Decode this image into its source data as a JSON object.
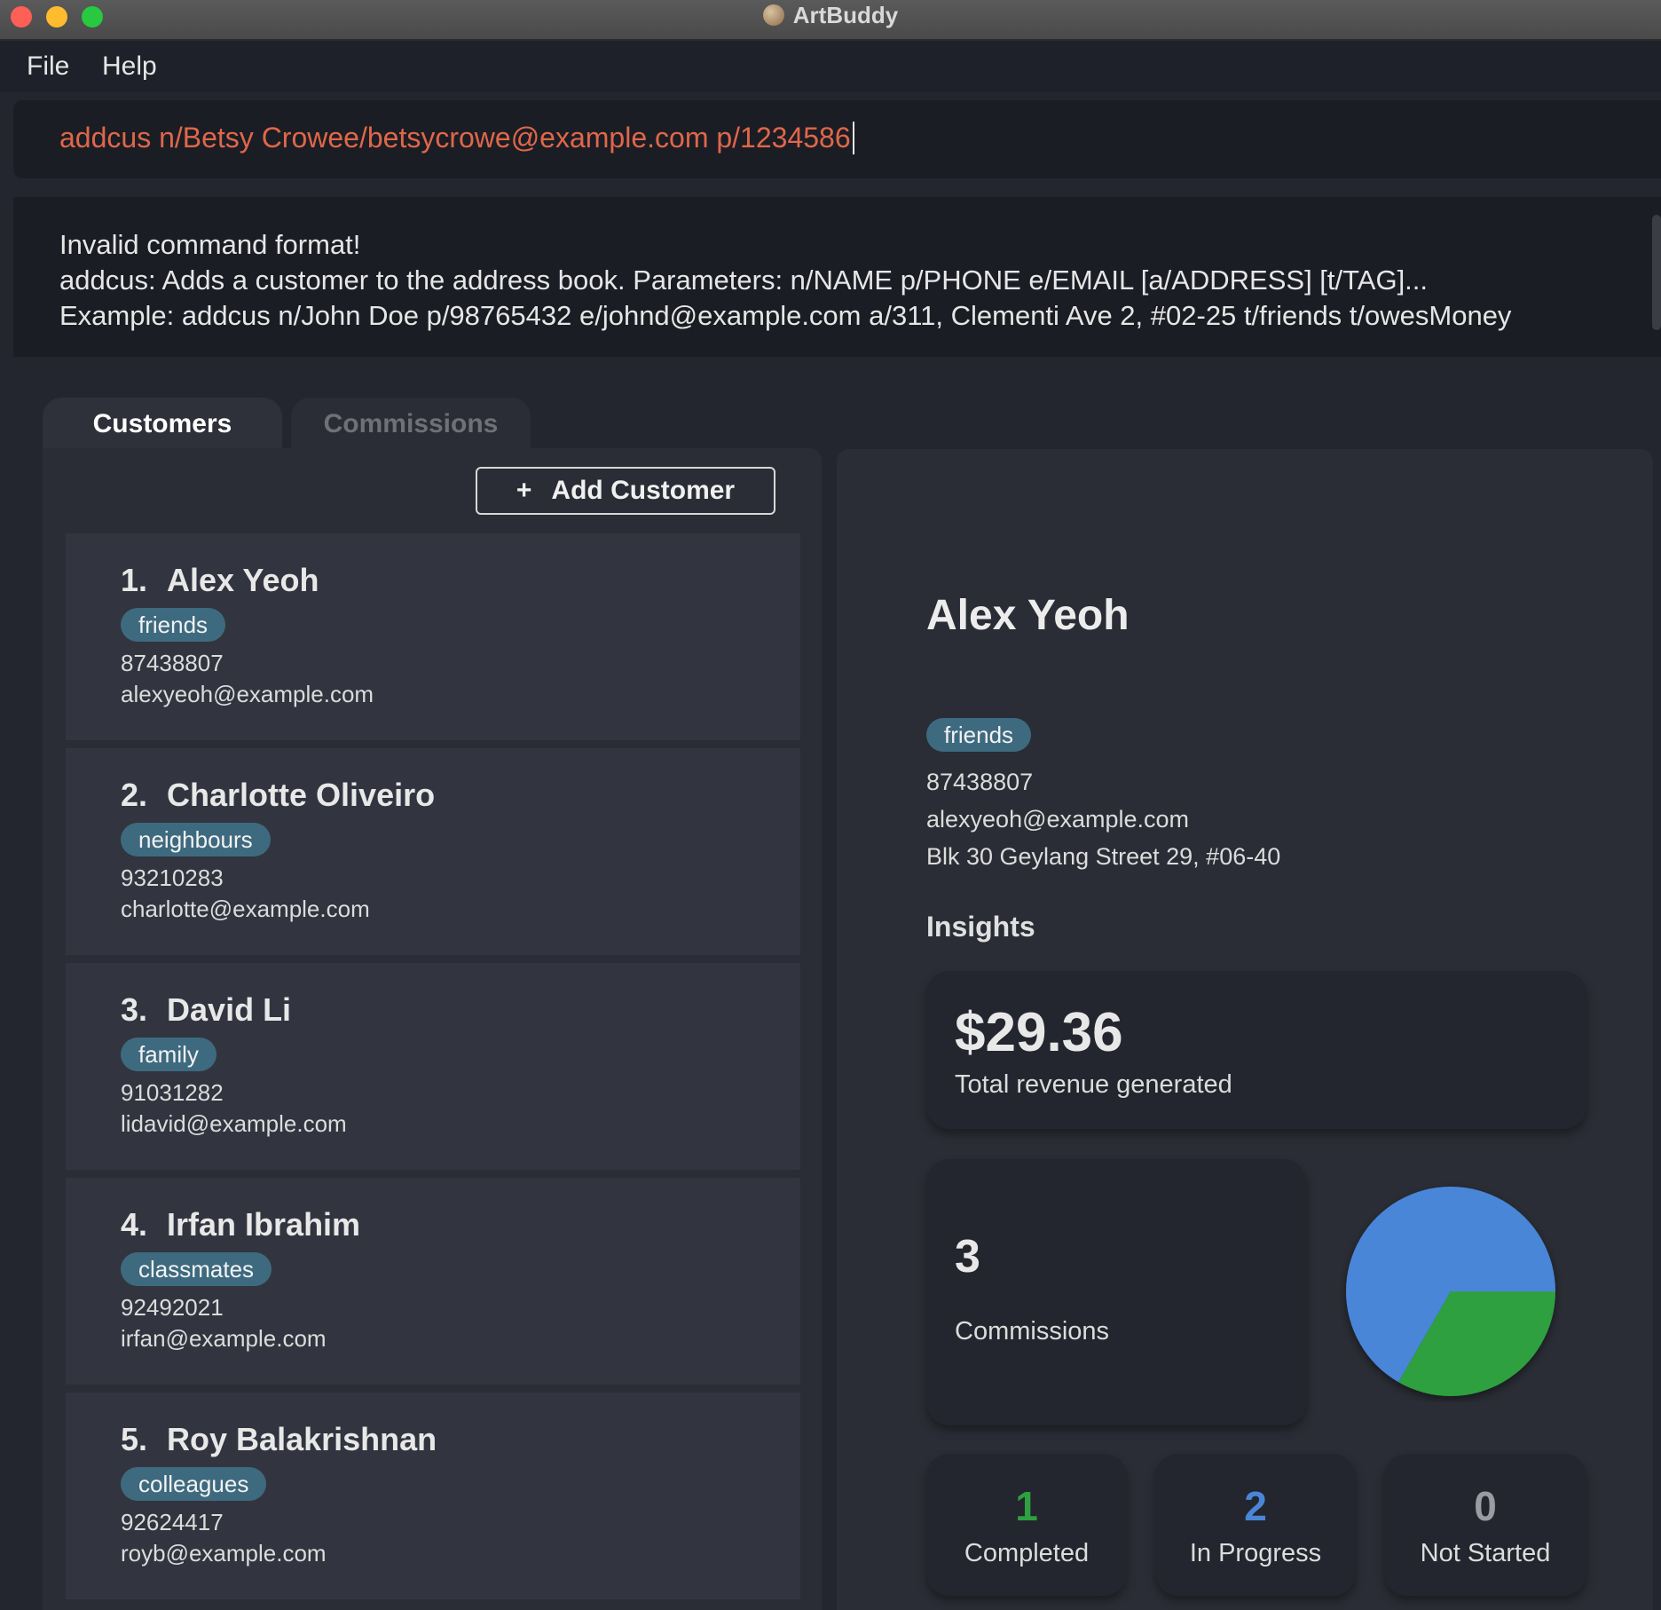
{
  "window": {
    "title": "ArtBuddy"
  },
  "menu": {
    "file": "File",
    "help": "Help"
  },
  "command": {
    "value": "addcus n/Betsy Crowee/betsycrowe@example.com p/1234586"
  },
  "result": {
    "line1": "Invalid command format!",
    "line2": "addcus: Adds a customer to the address book. Parameters: n/NAME p/PHONE e/EMAIL [a/ADDRESS] [t/TAG]...",
    "line3": "Example: addcus n/John Doe p/98765432 e/johnd@example.com a/311, Clementi Ave 2, #02-25 t/friends t/owesMoney"
  },
  "tabs": {
    "customers": "Customers",
    "commissions": "Commissions"
  },
  "add_button": {
    "icon": "+",
    "label": "Add Customer"
  },
  "customers": [
    {
      "index": "1.",
      "name": "Alex Yeoh",
      "tag": "friends",
      "phone": "87438807",
      "email": "alexyeoh@example.com"
    },
    {
      "index": "2.",
      "name": "Charlotte Oliveiro",
      "tag": "neighbours",
      "phone": "93210283",
      "email": "charlotte@example.com"
    },
    {
      "index": "3.",
      "name": "David Li",
      "tag": "family",
      "phone": "91031282",
      "email": "lidavid@example.com"
    },
    {
      "index": "4.",
      "name": "Irfan Ibrahim",
      "tag": "classmates",
      "phone": "92492021",
      "email": "irfan@example.com"
    },
    {
      "index": "5.",
      "name": "Roy Balakrishnan",
      "tag": "colleagues",
      "phone": "92624417",
      "email": "royb@example.com"
    }
  ],
  "detail": {
    "name": "Alex Yeoh",
    "tag": "friends",
    "phone": "87438807",
    "email": "alexyeoh@example.com",
    "address": "Blk 30 Geylang Street 29, #06-40",
    "insights_title": "Insights",
    "revenue_value": "$29.36",
    "revenue_label": "Total revenue generated",
    "commissions_count": "3",
    "commissions_label": "Commissions",
    "completed_value": "1",
    "completed_label": "Completed",
    "in_progress_value": "2",
    "in_progress_label": "In Progress",
    "not_started_value": "0",
    "not_started_label": "Not Started"
  },
  "pie": {
    "slices": [
      {
        "label": "In Progress",
        "value": 2,
        "color": "#4a86d8"
      },
      {
        "label": "Completed",
        "value": 1,
        "color": "#2fa040"
      }
    ]
  },
  "colors": {
    "command_text": "#e0674a",
    "tag_bg": "#3e6a7f",
    "completed": "#2fa040",
    "in_progress": "#4a86d8",
    "not_started": "#9a9ca3"
  }
}
